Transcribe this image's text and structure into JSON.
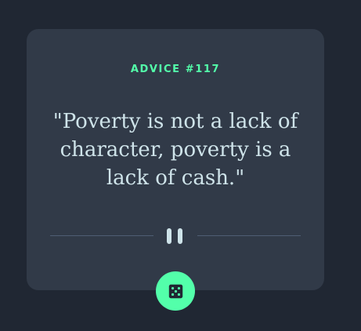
{
  "advice": {
    "title": "ADVICE #117",
    "quote": "\"Poverty is not a lack of character, poverty is a lack of cash.\""
  },
  "colors": {
    "background": "#202733",
    "card": "#313a48",
    "accent": "#53ffaa",
    "text": "#cee3e9",
    "divider": "#4f5d74"
  },
  "icons": {
    "divider": "pause-icon",
    "button": "dice-icon"
  }
}
